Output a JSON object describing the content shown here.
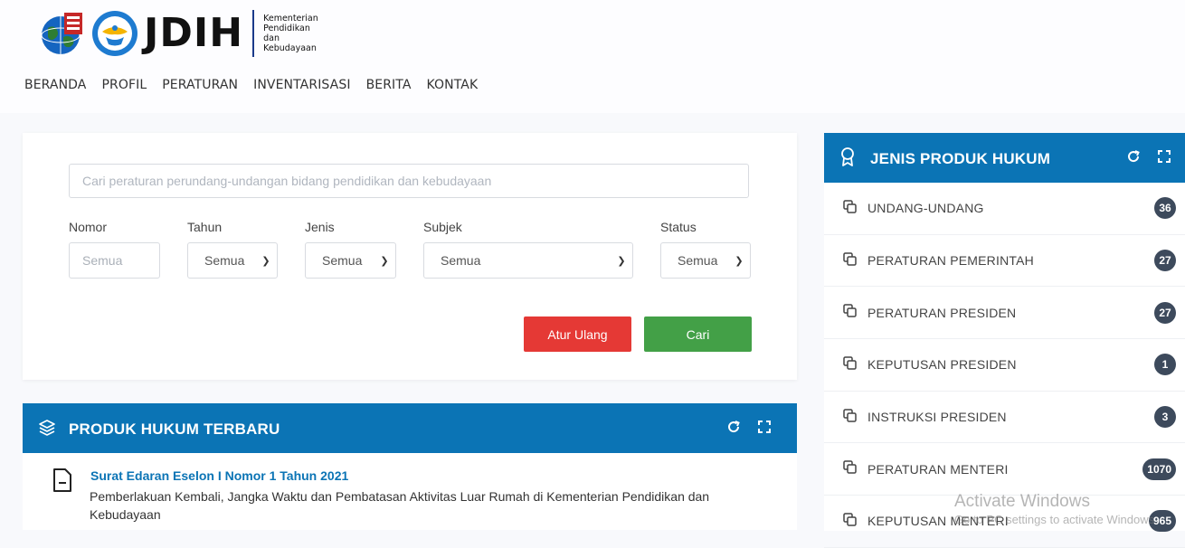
{
  "header": {
    "logo_text": "JDIH",
    "ministry_lines": [
      "Kementerian",
      "Pendidikan",
      "dan",
      "Kebudayaan"
    ],
    "nav": [
      "BERANDA",
      "PROFIL",
      "PERATURAN",
      "INVENTARISASI",
      "BERITA",
      "KONTAK"
    ]
  },
  "search": {
    "placeholder": "Cari peraturan perundang-undangan bidang pendidikan dan kebudayaan",
    "filters": {
      "nomor": {
        "label": "Nomor",
        "placeholder": "Semua"
      },
      "tahun": {
        "label": "Tahun",
        "value": "Semua"
      },
      "jenis": {
        "label": "Jenis",
        "value": "Semua"
      },
      "subjek": {
        "label": "Subjek",
        "value": "Semua"
      },
      "status": {
        "label": "Status",
        "value": "Semua"
      }
    },
    "reset_label": "Atur Ulang",
    "search_label": "Cari"
  },
  "produk": {
    "title": "PRODUK HUKUM TERBARU",
    "items": [
      {
        "title": "Surat Edaran Eselon I Nomor 1 Tahun 2021",
        "description": "Pemberlakuan Kembali, Jangka Waktu dan Pembatasan Aktivitas Luar Rumah di Kementerian Pendidikan dan Kebudayaan"
      }
    ]
  },
  "jenis": {
    "title": "JENIS PRODUK HUKUM",
    "items": [
      {
        "label": "UNDANG-UNDANG",
        "count": "36"
      },
      {
        "label": "PERATURAN PEMERINTAH",
        "count": "27"
      },
      {
        "label": "PERATURAN PRESIDEN",
        "count": "27"
      },
      {
        "label": "KEPUTUSAN PRESIDEN",
        "count": "1"
      },
      {
        "label": "INSTRUKSI PRESIDEN",
        "count": "3"
      },
      {
        "label": "PERATURAN MENTERI",
        "count": "1070"
      },
      {
        "label": "KEPUTUSAN MENTERI",
        "count": "965"
      }
    ]
  },
  "watermark": {
    "line1": "Activate Windows",
    "line2": "Go to PC settings to activate Windows."
  },
  "colors": {
    "primary": "#0b74b5",
    "reset": "#e53935",
    "search": "#43a047",
    "badge": "#3d4a5c"
  }
}
